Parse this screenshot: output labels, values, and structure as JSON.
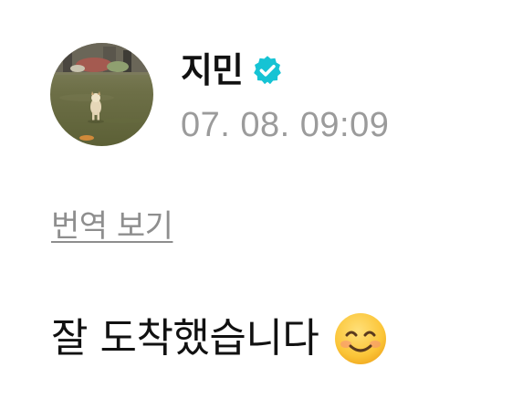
{
  "post": {
    "author": {
      "name": "지민",
      "verified": true,
      "verified_badge_color": "#16c3d4",
      "avatar": "profile photo of a small dog standing on a grass field"
    },
    "timestamp": "07. 08. 09:09",
    "translate_link": "번역 보기",
    "message": {
      "text": "잘 도착했습니다",
      "emoji": "smiling-face-with-smiling-eyes"
    }
  }
}
